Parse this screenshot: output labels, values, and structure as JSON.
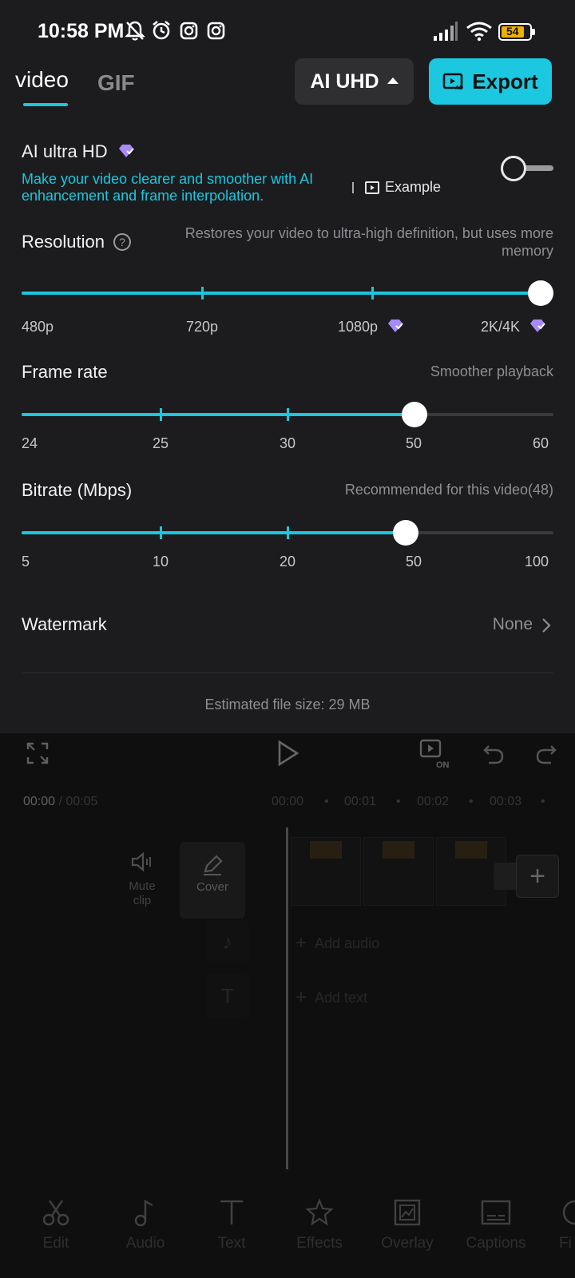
{
  "status_bar": {
    "time": "10:58 PM",
    "battery": "54",
    "icons": [
      "mute-bell-icon",
      "alarm-icon",
      "instagram-icon",
      "instagram-icon",
      "signal-icon",
      "wifi-icon",
      "battery-icon"
    ]
  },
  "tabs": [
    {
      "label": "video",
      "active": true
    },
    {
      "label": "GIF",
      "active": false
    }
  ],
  "header": {
    "quality_label": "AI UHD",
    "export_label": "Export"
  },
  "ai_uhd": {
    "title": "AI ultra HD",
    "description": "Make your video clearer and smoother with AI enhancement and frame interpolation.",
    "example_label": "Example",
    "enabled": false
  },
  "resolution": {
    "label": "Resolution",
    "hint": "Restores your video to ultra-high definition, but uses more memory",
    "options": [
      "480p",
      "720p",
      "1080p",
      "2K/4K"
    ],
    "selected_index": 3
  },
  "frame_rate": {
    "label": "Frame rate",
    "hint": "Smoother playback",
    "options": [
      "24",
      "25",
      "30",
      "50",
      "60"
    ],
    "selected_index": 3
  },
  "bitrate": {
    "label": "Bitrate (Mbps)",
    "hint": "Recommended for this video(48)",
    "options": [
      "5",
      "10",
      "20",
      "50",
      "100"
    ],
    "selected_position": 0.72
  },
  "watermark": {
    "label": "Watermark",
    "value": "None"
  },
  "estimated_file_size": "Estimated file size: 29 MB",
  "editor": {
    "current_time": "00:00",
    "total_time": "/ 00:05",
    "ruler": [
      "00:00",
      "00:01",
      "00:02",
      "00:03"
    ],
    "mute_clip_label": "Mute clip",
    "cover_label": "Cover",
    "add_audio_label": "Add audio",
    "add_text_label": "Add text"
  },
  "bottom_nav": [
    {
      "label": "Edit",
      "icon": "scissors-icon"
    },
    {
      "label": "Audio",
      "icon": "music-note-icon"
    },
    {
      "label": "Text",
      "icon": "text-icon"
    },
    {
      "label": "Effects",
      "icon": "star-icon"
    },
    {
      "label": "Overlay",
      "icon": "overlay-icon"
    },
    {
      "label": "Captions",
      "icon": "captions-icon"
    },
    {
      "label": "Fi",
      "icon": "filter-icon"
    }
  ],
  "colors": {
    "accent": "#1cc6df",
    "panel_bg": "#1c1c1e",
    "premium": "#a78bfa"
  }
}
